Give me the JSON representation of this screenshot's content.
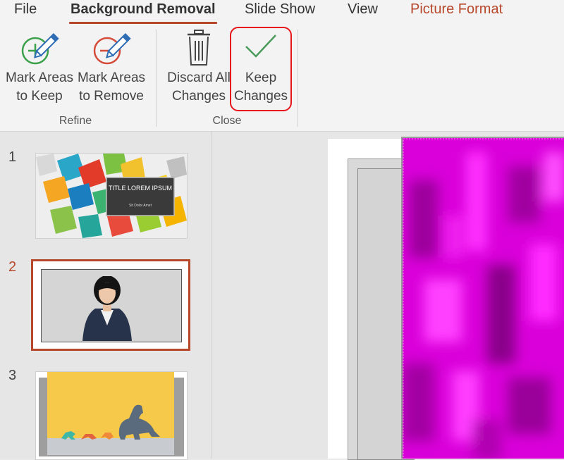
{
  "tabs": [
    {
      "label": "File"
    },
    {
      "label": "Background Removal"
    },
    {
      "label": "Slide Show"
    },
    {
      "label": "View"
    },
    {
      "label": "Picture Format"
    }
  ],
  "ribbon": {
    "mark_keep": {
      "line1": "Mark Areas",
      "line2": "to Keep",
      "icon": "plus-pencil-icon"
    },
    "mark_remove": {
      "line1": "Mark Areas",
      "line2": "to Remove",
      "icon": "minus-pencil-icon"
    },
    "discard": {
      "line1": "Discard All",
      "line2": "Changes",
      "icon": "trash-icon"
    },
    "keep": {
      "line1": "Keep",
      "line2": "Changes",
      "icon": "checkmark-icon"
    },
    "groups": {
      "refine": "Refine",
      "close": "Close"
    }
  },
  "slides": [
    {
      "number": "1",
      "title": "TITLE LOREM IPSUM",
      "subtitle": "Sit Dolor Amet"
    },
    {
      "number": "2"
    },
    {
      "number": "3"
    }
  ],
  "colors": {
    "accent": "#b7472a",
    "highlight": "#e8141c",
    "magenta": "#e600e6",
    "check_green": "#4a9a5a"
  }
}
